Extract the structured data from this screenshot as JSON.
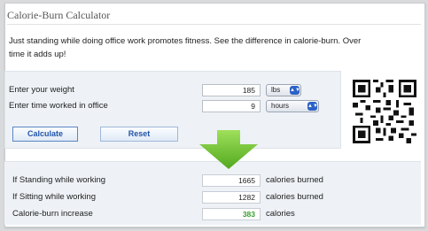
{
  "app": {
    "title": "Calorie-Burn Calculator"
  },
  "intro": {
    "line1": "Just standing while doing office work promotes fitness. See the difference in calorie-burn. Over",
    "line2": "time it adds up!"
  },
  "form": {
    "weight_label": "Enter your weight",
    "weight_value": "185",
    "weight_unit": "lbs",
    "time_label": "Enter time worked in office",
    "time_value": "9",
    "time_unit": "hours",
    "calculate_label": "Calculate",
    "reset_label": "Reset"
  },
  "results": {
    "standing_label": "If Standing while working",
    "standing_value": "1665",
    "standing_unit": "calories burned",
    "sitting_label": "If Sitting while working",
    "sitting_value": "1282",
    "sitting_unit": "calories burned",
    "increase_label": "Calorie-burn increase",
    "increase_value": "383",
    "increase_unit": "calories"
  },
  "icons": {
    "arrow": "down-arrow-icon",
    "qr": "qr-code-icon",
    "select_arrow": "select-stepper-icon"
  },
  "colors": {
    "accent_blue": "#2c62c7",
    "arrow_green": "#6cc12f",
    "increase_green": "#3aa030",
    "panel_bg": "#eef2f6"
  }
}
